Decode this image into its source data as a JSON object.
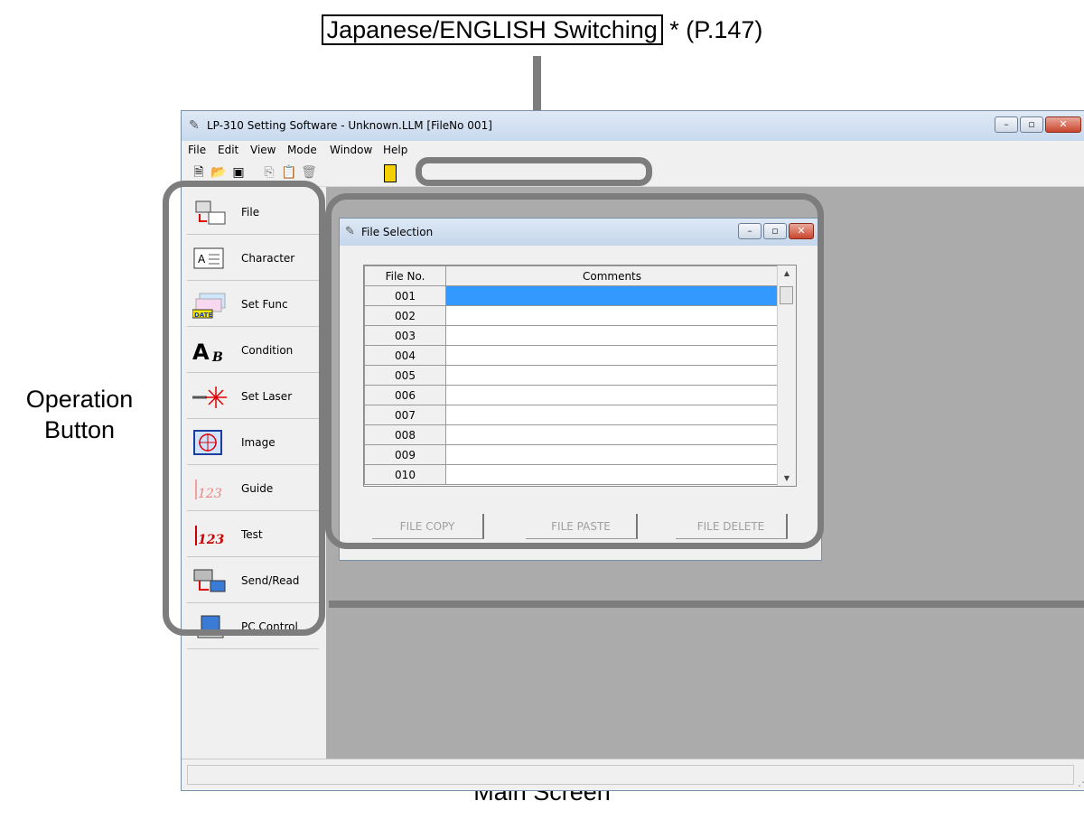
{
  "annotations": {
    "top_boxed": "Japanese/ENGLISH Switching",
    "top_suffix": " * (P.147)",
    "left_line1": "Operation",
    "left_line2": "Button",
    "bottom": "Main Screen"
  },
  "window": {
    "title": "LP-310 Setting Software - Unknown.LLM  [FileNo 001]",
    "app_icon": "laser-marker-icon"
  },
  "menu": [
    "File",
    "Edit",
    "View",
    "Mode",
    "Window",
    "Help"
  ],
  "toolbar_icons": [
    "new-icon",
    "open-icon",
    "save-icon",
    "copy-icon",
    "paste-icon",
    "delete-icon",
    "exit-icon"
  ],
  "operation_buttons": [
    {
      "label": "File",
      "icon": "file-icon"
    },
    {
      "label": "Character",
      "icon": "character-icon"
    },
    {
      "label": "Set Func",
      "icon": "date-icon",
      "icon_text": "DATE"
    },
    {
      "label": "Condition",
      "icon": "condition-icon",
      "icon_text": "A"
    },
    {
      "label": "Set Laser",
      "icon": "laser-icon"
    },
    {
      "label": "Image",
      "icon": "image-icon"
    },
    {
      "label": "Guide",
      "icon": "guide-icon",
      "icon_text": "123"
    },
    {
      "label": "Test",
      "icon": "test-icon",
      "icon_text": "123"
    },
    {
      "label": "Send/Read",
      "icon": "send-read-icon"
    },
    {
      "label": "PC Control",
      "icon": "pc-icon"
    }
  ],
  "file_selection": {
    "title": "File Selection",
    "col_no": "File No.",
    "col_comments": "Comments",
    "rows": [
      {
        "no": "001",
        "comment": ""
      },
      {
        "no": "002",
        "comment": ""
      },
      {
        "no": "003",
        "comment": ""
      },
      {
        "no": "004",
        "comment": ""
      },
      {
        "no": "005",
        "comment": ""
      },
      {
        "no": "006",
        "comment": ""
      },
      {
        "no": "007",
        "comment": ""
      },
      {
        "no": "008",
        "comment": ""
      },
      {
        "no": "009",
        "comment": ""
      },
      {
        "no": "010",
        "comment": ""
      }
    ],
    "selected_row": "001",
    "buttons": {
      "copy": "FILE COPY",
      "paste": "FILE PASTE",
      "delete": "FILE DELETE"
    }
  },
  "colors": {
    "selection": "#3399ff",
    "highlight": "#7d7d7d",
    "mdi_background": "#ababab",
    "test_red": "#cc0000"
  }
}
